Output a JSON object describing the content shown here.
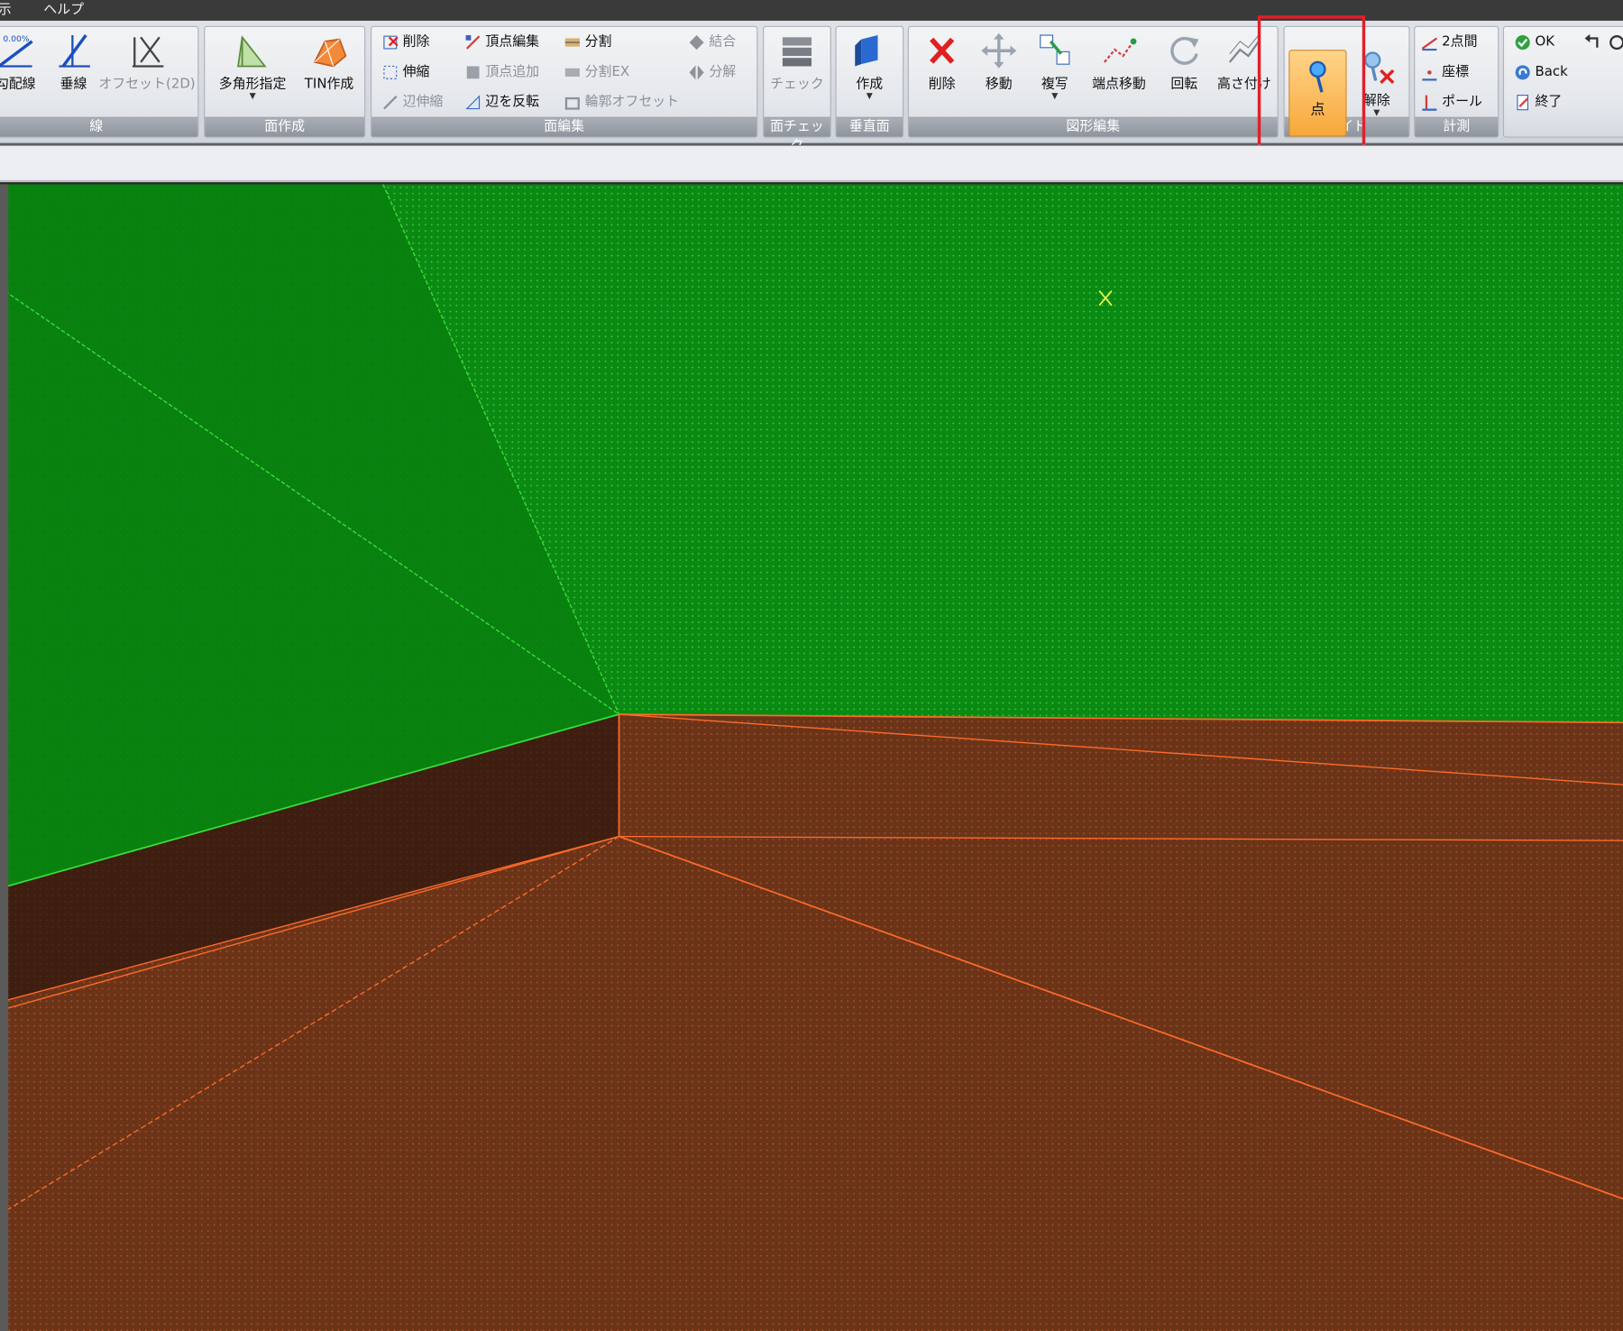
{
  "menu": {
    "item_left": "示",
    "help": "ヘルプ"
  },
  "ribbon": {
    "groups": {
      "line": {
        "title": "線",
        "gradient_line": "勾配線",
        "vertical_line": "垂線",
        "offset_2d": "オフセット(2D)"
      },
      "face_create": {
        "title": "面作成",
        "polygon": "多角形指定",
        "tin": "TIN作成"
      },
      "face_edit": {
        "title": "面編集",
        "delete": "削除",
        "vertex_edit": "頂点編集",
        "split": "分割",
        "join": "結合",
        "stretch": "伸縮",
        "vertex_add": "頂点追加",
        "split_ex": "分割EX",
        "decompose": "分解",
        "edge_stretch": "辺伸縮",
        "edge_flip": "辺を反転",
        "outline_offset": "輪郭オフセット"
      },
      "face_check": {
        "title": "面チェック",
        "check": "チェック"
      },
      "vertical_face": {
        "title": "垂直面",
        "create": "作成"
      },
      "shape_edit": {
        "title": "図形編集",
        "delete": "削除",
        "move": "移動",
        "copy": "複写",
        "endpoint_move": "端点移動",
        "rotate": "回転",
        "height": "高さ付け"
      },
      "guide": {
        "title": "ガイド",
        "point": "点",
        "release": "解除"
      },
      "measure": {
        "title": "計測",
        "two_point": "2点間",
        "coords": "座標",
        "pole": "ポール"
      },
      "confirm": {
        "ok": "OK",
        "back": "Back",
        "end": "終了"
      }
    }
  },
  "colors": {
    "ground_green": "#0a8a12",
    "terrain_brown": "#6b3418",
    "shadow_face": "#3e1e10",
    "green_edge": "#3adf3a",
    "orange_edge": "#ff6a2a",
    "active_button": "#f8a83a",
    "highlight_red": "#e0202a"
  }
}
